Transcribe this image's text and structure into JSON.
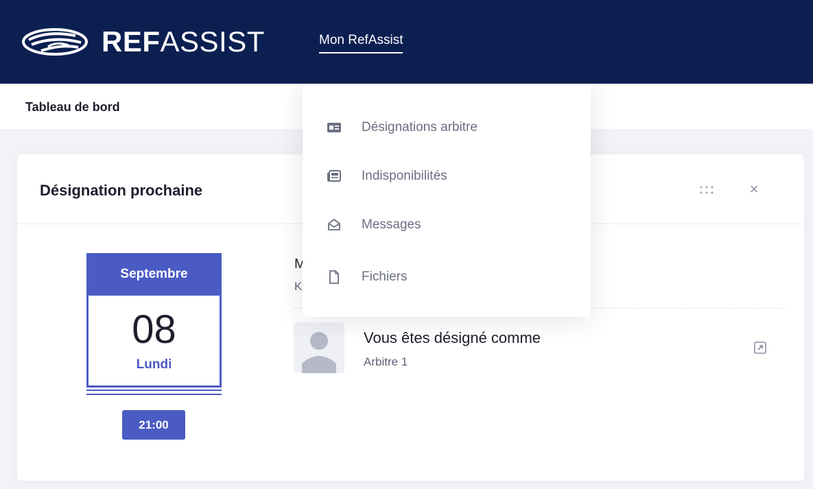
{
  "header": {
    "brand_bold": "REF",
    "brand_light": "ASSIST",
    "nav_link": "Mon RefAssist"
  },
  "subheader": {
    "title": "Tableau de bord"
  },
  "dropdown": {
    "items": [
      {
        "label": "Désignations arbitre",
        "icon": "id-card-icon"
      },
      {
        "label": "Indisponibilités",
        "icon": "newspaper-icon"
      },
      {
        "label": "Messages",
        "icon": "envelope-open-icon"
      },
      {
        "label": "Fichiers",
        "icon": "file-icon"
      }
    ]
  },
  "card": {
    "title": "Désignation prochaine",
    "calendar": {
      "month": "Septembre",
      "day": "08",
      "weekday": "Lundi",
      "time": "21:00"
    },
    "partial_lines": [
      "M",
      "K"
    ],
    "assignment": {
      "title": "Vous êtes désigné comme",
      "role": "Arbitre 1"
    }
  },
  "colors": {
    "navy": "#0b1f51",
    "accent": "#4a5bc4"
  }
}
